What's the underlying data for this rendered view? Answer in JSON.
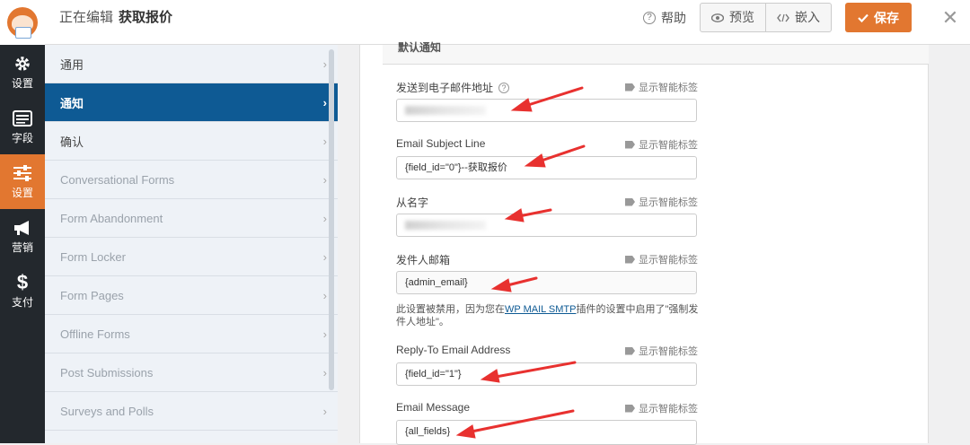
{
  "header": {
    "title_prefix": "正在编辑",
    "form_name": "获取报价",
    "help_label": "帮助",
    "preview_label": "预览",
    "embed_label": "嵌入",
    "save_label": "保存"
  },
  "nav": [
    {
      "label": "设置",
      "icon": "gear-icon"
    },
    {
      "label": "字段",
      "icon": "list-icon"
    },
    {
      "label": "设置",
      "icon": "sliders-icon",
      "active": true
    },
    {
      "label": "营销",
      "icon": "megaphone-icon"
    },
    {
      "label": "支付",
      "icon": "dollar-icon"
    }
  ],
  "subnav": [
    {
      "label": "通用"
    },
    {
      "label": "通知",
      "active": true
    },
    {
      "label": "确认"
    },
    {
      "label": "Conversational Forms"
    },
    {
      "label": "Form Abandonment"
    },
    {
      "label": "Form Locker"
    },
    {
      "label": "Form Pages"
    },
    {
      "label": "Offline Forms"
    },
    {
      "label": "Post Submissions"
    },
    {
      "label": "Surveys and Polls"
    }
  ],
  "section_title": "默认通知",
  "smart_tags_label": "显示智能标签",
  "fields": [
    {
      "label": "发送到电子邮件地址",
      "value": "",
      "help": true
    },
    {
      "label": "Email Subject Line",
      "value": "{field_id=\"0\"}--获取报价"
    },
    {
      "label": "从名字",
      "value": ""
    },
    {
      "label": "发件人邮箱",
      "value": "{admin_email}"
    },
    {
      "label": "Reply-To Email Address",
      "value": "{field_id=\"1\"}"
    },
    {
      "label": "Email Message",
      "value": "{all_fields}"
    }
  ],
  "note": {
    "before": "此设置被禁用，因为您在",
    "link": "WP MAIL SMTP",
    "after": "插件的设置中启用了\"强制发件人地址\"。"
  },
  "accent_color": "#e27730",
  "active_subnav_color": "#0e5a94",
  "arrow_color": "#e8312f"
}
